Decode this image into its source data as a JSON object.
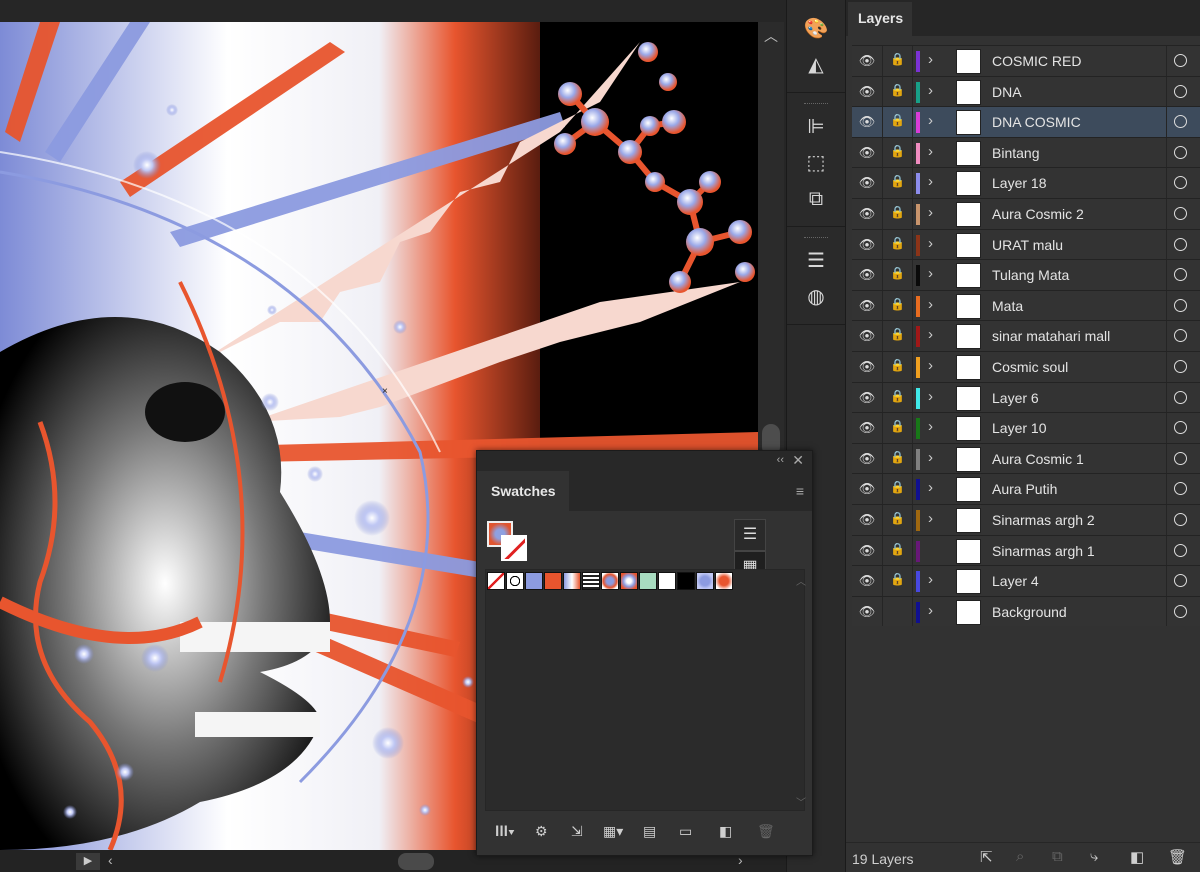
{
  "colors": {
    "accent_orange": "#e8552e",
    "periwinkle": "#8c9be0",
    "panel_bg": "#323232",
    "selected_row": "#3d4b5c"
  },
  "canvas": {
    "description_icons": [
      "scroll-up-chevron",
      "scroll-left-chevron",
      "scroll-right-chevron",
      "play-icon"
    ]
  },
  "toolstrip": {
    "tools": [
      "color-palette-icon",
      "gradient-icon",
      "align-icon",
      "transform-icon",
      "pathfinder-icon",
      "stroke-icon",
      "appearance-icon"
    ]
  },
  "swatches": {
    "title": "Swatches",
    "swatch_colors": [
      "none",
      "registration",
      "#8c9be0",
      "#e8552e",
      "gradient-pw",
      "pattern",
      "radial-1",
      "radial-2",
      "#a8dcc0",
      "#ffffff",
      "#000000",
      "radial-3",
      "radial-4"
    ]
  },
  "layers": {
    "title": "Layers",
    "count_label": "19 Layers",
    "items": [
      {
        "name": "COSMIC RED",
        "color": "#7b32d4",
        "locked": true,
        "expandable": true,
        "selected": false
      },
      {
        "name": "DNA",
        "color": "#18a088",
        "locked": true,
        "expandable": true,
        "selected": false
      },
      {
        "name": "DNA COSMIC",
        "color": "#d83cd8",
        "locked": true,
        "expandable": true,
        "selected": true
      },
      {
        "name": "Bintang",
        "color": "#f08cc0",
        "locked": true,
        "expandable": true,
        "selected": false
      },
      {
        "name": "Layer 18",
        "color": "#8c8cec",
        "locked": true,
        "expandable": true,
        "selected": false
      },
      {
        "name": "Aura Cosmic 2",
        "color": "#c8946c",
        "locked": true,
        "expandable": true,
        "selected": false
      },
      {
        "name": "URAT malu",
        "color": "#8c3418",
        "locked": true,
        "expandable": true,
        "selected": false
      },
      {
        "name": "Tulang Mata",
        "color": "#0a0a0a",
        "locked": true,
        "expandable": true,
        "selected": false
      },
      {
        "name": "Mata",
        "color": "#e86c20",
        "locked": true,
        "expandable": true,
        "selected": false
      },
      {
        "name": "sinar matahari mall",
        "color": "#a01818",
        "locked": true,
        "expandable": true,
        "selected": false
      },
      {
        "name": "Cosmic soul",
        "color": "#f0a020",
        "locked": true,
        "expandable": true,
        "selected": false
      },
      {
        "name": "Layer 6",
        "color": "#40e8e8",
        "locked": true,
        "expandable": true,
        "selected": false
      },
      {
        "name": "Layer 10",
        "color": "#187818",
        "locked": true,
        "expandable": true,
        "selected": false
      },
      {
        "name": "Aura Cosmic 1",
        "color": "#808080",
        "locked": true,
        "expandable": true,
        "selected": false
      },
      {
        "name": "Aura Putih",
        "color": "#101090",
        "locked": true,
        "expandable": true,
        "selected": false
      },
      {
        "name": "Sinarmas argh 2",
        "color": "#a06810",
        "locked": true,
        "expandable": true,
        "selected": false
      },
      {
        "name": "Sinarmas argh 1",
        "color": "#681878",
        "locked": true,
        "expandable": false,
        "selected": false
      },
      {
        "name": "Layer 4",
        "color": "#4848e0",
        "locked": true,
        "expandable": true,
        "selected": false
      },
      {
        "name": "Background",
        "color": "#101090",
        "locked": false,
        "expandable": true,
        "selected": false
      }
    ]
  }
}
